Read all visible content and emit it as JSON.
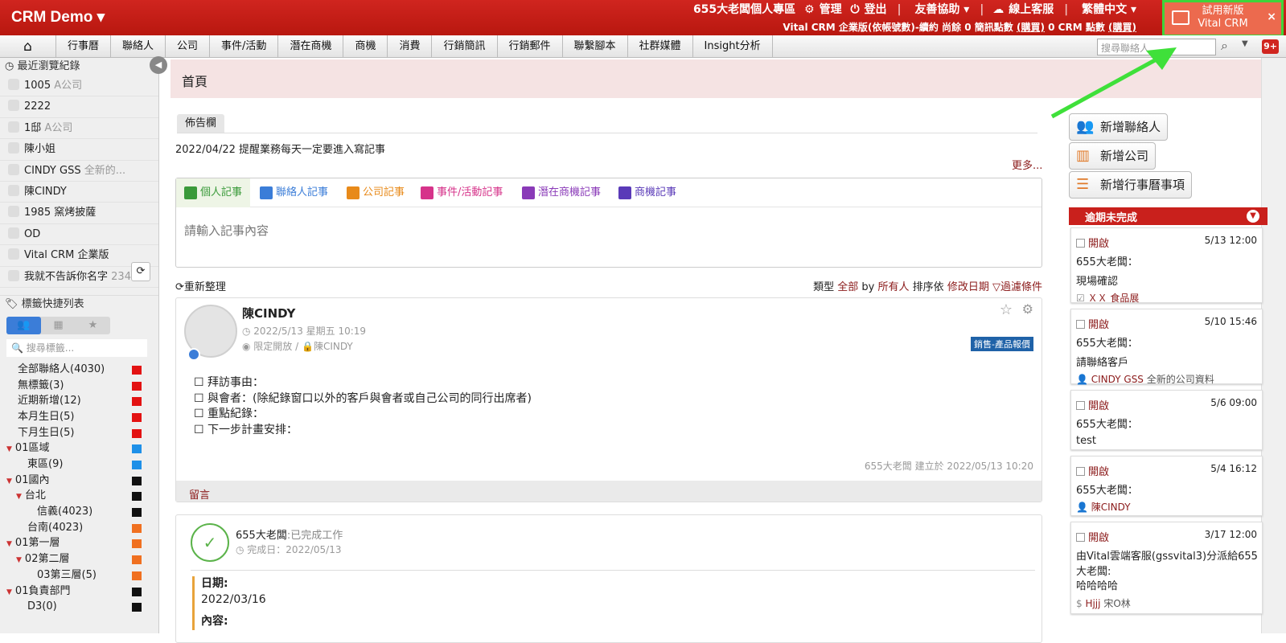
{
  "topbar": {
    "brand": "CRM Demo",
    "user": "655大老闆個人專區",
    "manage": "管理",
    "logout": "登出",
    "partner": "友善協助",
    "service": "線上客服",
    "lang": "繁體中文",
    "edition": "Vital CRM 企業版(依帳號數)-續約",
    "sms_pre": "尚餘 0 簡訊點數",
    "buy1": "(購買)",
    "crm_pts": "0 CRM 點數",
    "buy2": "(購買)"
  },
  "trial": {
    "line1": "試用新版",
    "line2": "Vital CRM",
    "close": "×"
  },
  "nav": {
    "items": [
      "行事曆",
      "聯絡人",
      "公司",
      "事件/活動",
      "潛在商機",
      "商機",
      "消費",
      "行銷簡訊",
      "行銷郵件",
      "聯繫腳本",
      "社群媒體",
      "Insight分析"
    ],
    "search_placeholder": "搜尋聯絡人",
    "badge": "9+"
  },
  "sidebar": {
    "recent_title": "最近瀏覽紀錄",
    "recent": [
      {
        "name": "1005",
        "company": "A公司"
      },
      {
        "name": "2222",
        "company": ""
      },
      {
        "name": "1邸",
        "company": "A公司"
      },
      {
        "name": "陳小姐",
        "company": ""
      },
      {
        "name": "CINDY GSS",
        "company": "全新的..."
      },
      {
        "name": "陳CINDY",
        "company": ""
      },
      {
        "name": "1985 窯烤披薩",
        "company": ""
      },
      {
        "name": "OD",
        "company": ""
      },
      {
        "name": "Vital CRM 企業版",
        "company": ""
      },
      {
        "name": "我就不告訴你名字",
        "company": "234"
      }
    ],
    "tag_title": "標籤快捷列表",
    "tag_search": "搜尋標籤...",
    "tags": [
      {
        "label": "全部聯絡人(4030)",
        "color": "#e31212",
        "indent": 0,
        "tri": false
      },
      {
        "label": "無標籤(3)",
        "color": "#e31212",
        "indent": 0,
        "tri": false
      },
      {
        "label": "近期新增(12)",
        "color": "#e31212",
        "indent": 0,
        "tri": false
      },
      {
        "label": "本月生日(5)",
        "color": "#e31212",
        "indent": 0,
        "tri": false
      },
      {
        "label": "下月生日(5)",
        "color": "#e31212",
        "indent": 0,
        "tri": false
      },
      {
        "label": "01區域",
        "color": "#1e90e8",
        "indent": 0,
        "tri": true
      },
      {
        "label": "東區(9)",
        "color": "#1e90e8",
        "indent": 1,
        "tri": false
      },
      {
        "label": "01國內",
        "color": "#111111",
        "indent": 0,
        "tri": true
      },
      {
        "label": "台北",
        "color": "#111111",
        "indent": 1,
        "tri": true
      },
      {
        "label": "信義(4023)",
        "color": "#111111",
        "indent": 2,
        "tri": false
      },
      {
        "label": "台南(4023)",
        "color": "#f07020",
        "indent": 1,
        "tri": false
      },
      {
        "label": "01第一層",
        "color": "#f07020",
        "indent": 0,
        "tri": true
      },
      {
        "label": "02第二層",
        "color": "#f07020",
        "indent": 1,
        "tri": true
      },
      {
        "label": "03第三層(5)",
        "color": "#f07020",
        "indent": 2,
        "tri": false
      },
      {
        "label": "01負責部門",
        "color": "#111111",
        "indent": 0,
        "tri": true
      },
      {
        "label": "D3(0)",
        "color": "#111111",
        "indent": 1,
        "tri": false
      }
    ]
  },
  "main": {
    "page_title": "首頁",
    "bulletin_tab": "佈告欄",
    "bulletin_text": "2022/04/22 提醒業務每天一定要進入寫記事",
    "more": "更多...",
    "note_tabs": [
      {
        "label": "個人記事",
        "color": "#3a9a3a"
      },
      {
        "label": "聯絡人記事",
        "color": "#3b7dd8"
      },
      {
        "label": "公司記事",
        "color": "#e88a1a"
      },
      {
        "label": "事件/活動記事",
        "color": "#d6338a"
      },
      {
        "label": "潛在商機記事",
        "color": "#8a3ab8"
      },
      {
        "label": "商機記事",
        "color": "#5a3ab8"
      }
    ],
    "note_placeholder": "請輸入記事內容",
    "refresh": "重新整理",
    "filter": {
      "type_label": "類型",
      "type_val": "全部",
      "by_label": "by",
      "by_val": "所有人",
      "sort_label": "排序依",
      "sort_val": "修改日期",
      "filter_link": "過濾條件"
    },
    "post1": {
      "name": "陳CINDY",
      "date": "2022/5/13 星期五 10:19",
      "privacy": "限定開放",
      "owner": "陳CINDY",
      "tag": "銷售-產品報價",
      "lines": [
        "拜訪事由：",
        "與會者：(除紀錄窗口以外的客戶與會者或自己公司的同行出席者)",
        "重點紀錄：",
        "下一步計畫安排："
      ],
      "footer": "655大老闆 建立於 2022/05/13 10:20",
      "comment": "留言"
    },
    "post2": {
      "who": "655大老闆",
      "action": ":已完成工作",
      "done_date": "完成日：2022/05/13",
      "date_label": "日期:",
      "date_val": "2022/03/16",
      "content_label": "內容:"
    }
  },
  "right": {
    "btn_contact": "新增聯絡人",
    "btn_company": "新增公司",
    "btn_calendar": "新增行事曆事項",
    "overdue_title": "逾期未完成",
    "tasks": [
      {
        "status": "開啟",
        "date": "5/13 12:00",
        "owner": "655大老闆：",
        "desc": "現場確認",
        "rel": "ＸＸ 食品展",
        "rel_extra": ""
      },
      {
        "status": "開啟",
        "date": "5/10 15:46",
        "owner": "655大老闆：",
        "desc": "請聯絡客戶",
        "rel": "CINDY GSS",
        "rel_extra": "全新的公司資料"
      },
      {
        "status": "開啟",
        "date": "5/6 09:00",
        "owner": "655大老闆：",
        "desc": "test",
        "rel": "",
        "rel_extra": ""
      },
      {
        "status": "開啟",
        "date": "5/4 16:12",
        "owner": "655大老闆：",
        "desc": "",
        "rel": "陳CINDY",
        "rel_extra": ""
      },
      {
        "status": "開啟",
        "date": "3/17 12:00",
        "owner": "由Vital雲端客服(gssvital3)分派給655大老闆:",
        "desc": "哈哈哈哈",
        "rel": "Hjjj",
        "rel_extra": "宋O林"
      }
    ]
  }
}
